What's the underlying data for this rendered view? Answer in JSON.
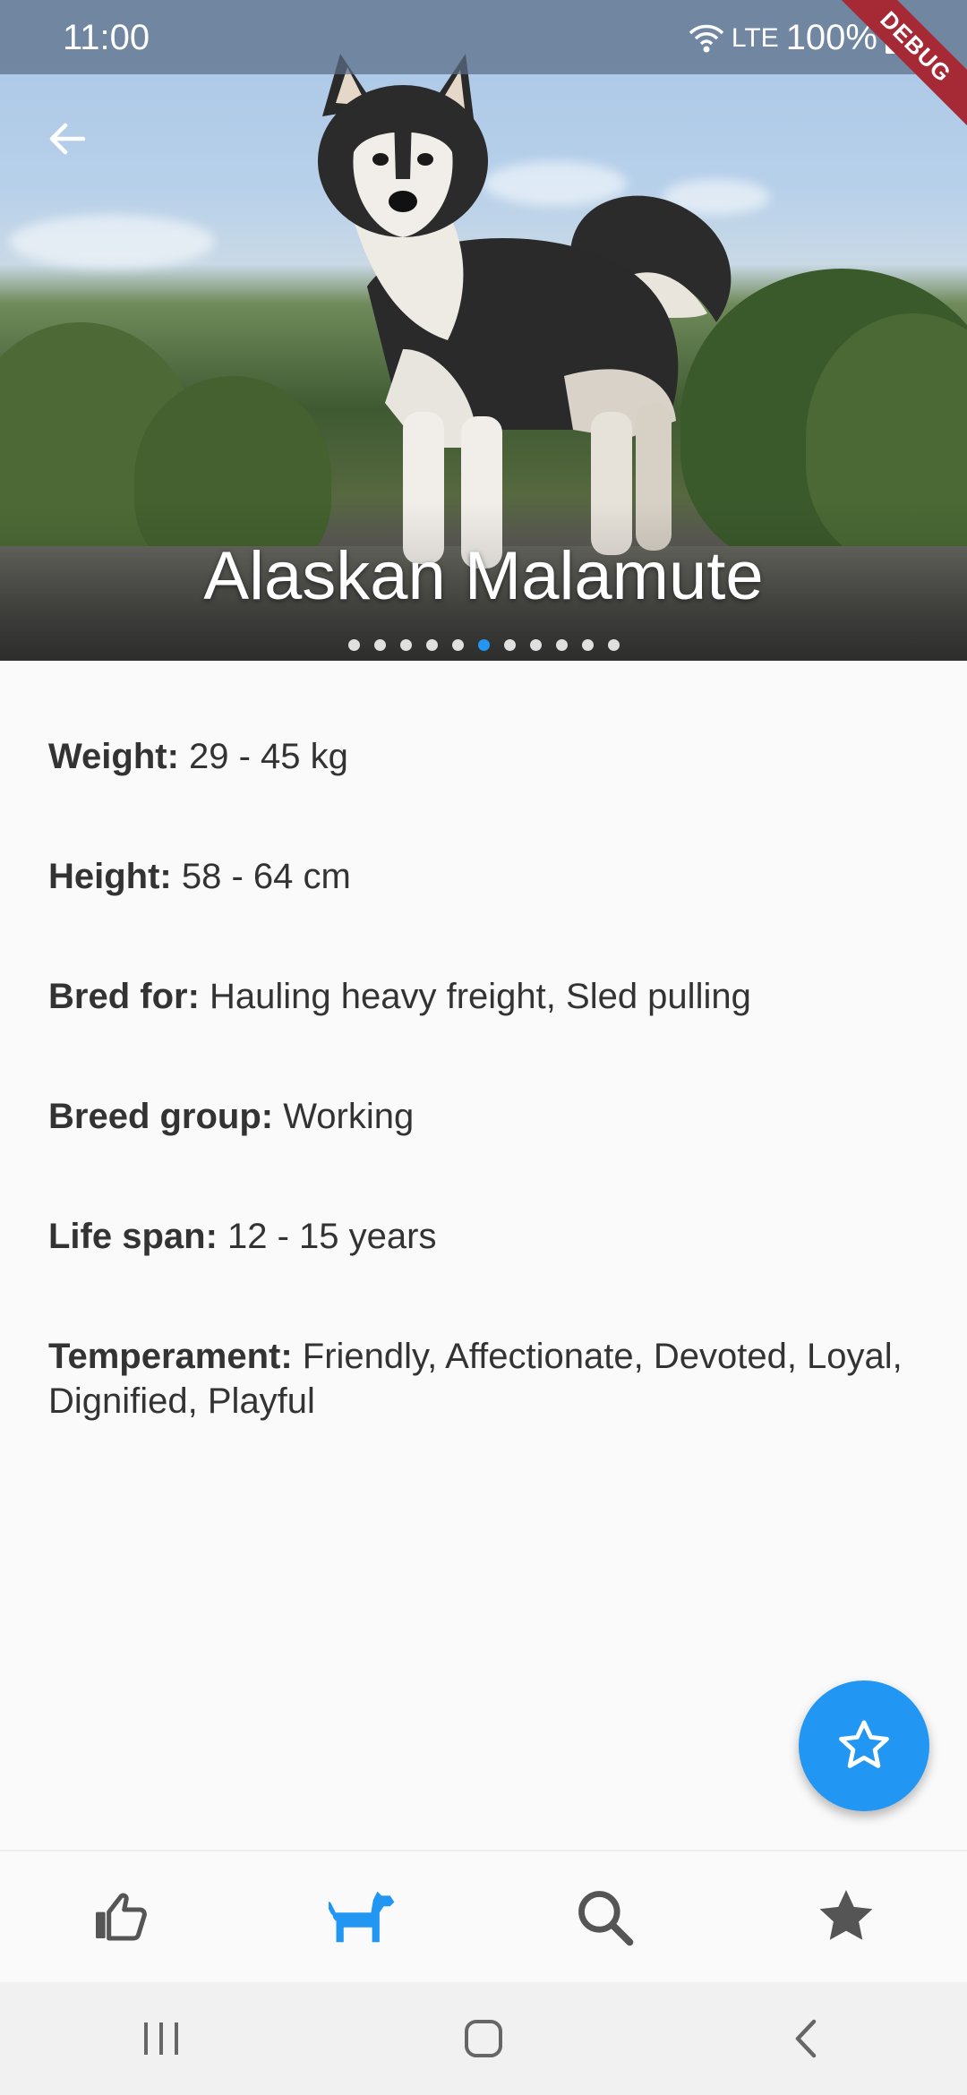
{
  "status_bar": {
    "time": "11:00",
    "network": "LTE",
    "battery": "100%",
    "debug_label": "DEBUG"
  },
  "breed": {
    "name": "Alaskan Malamute",
    "image_count": 11,
    "active_image_index": 5
  },
  "details": [
    {
      "label": "Weight:",
      "value": " 29 - 45 kg"
    },
    {
      "label": "Height:",
      "value": " 58 - 64 cm"
    },
    {
      "label": "Bred for:",
      "value": " Hauling heavy freight, Sled pulling"
    },
    {
      "label": "Breed group:",
      "value": " Working"
    },
    {
      "label": "Life span:",
      "value": " 12 - 15 years"
    },
    {
      "label": "Temperament:",
      "value": " Friendly, Affectionate, Devoted, Loyal, Dignified, Playful"
    }
  ],
  "icons": {
    "back": "arrow-back-icon",
    "fab": "star-outline-icon",
    "nav": [
      "thumb-up-icon",
      "dog-icon",
      "search-icon",
      "star-icon"
    ]
  },
  "colors": {
    "accent": "#2196f3",
    "nav_inactive": "#555555",
    "text": "#333333"
  },
  "bottom_nav": {
    "active_index": 1
  }
}
